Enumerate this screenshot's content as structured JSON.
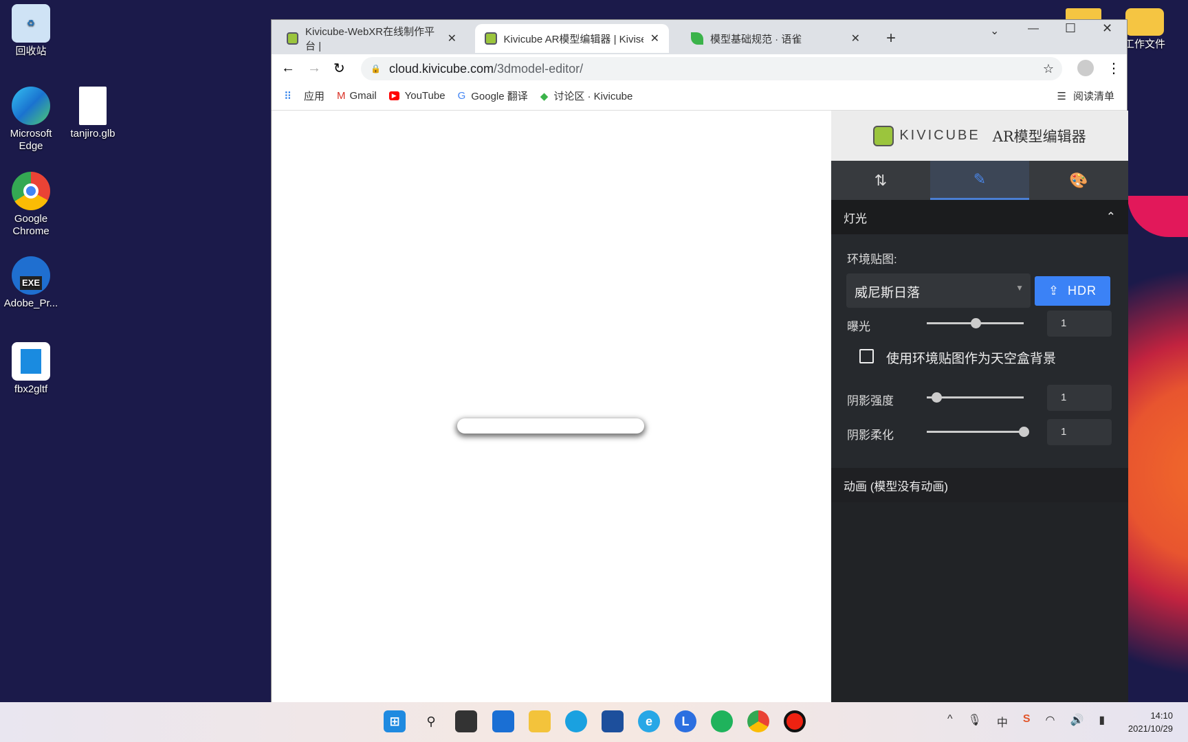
{
  "desktop": {
    "icons": [
      {
        "label": "回收站"
      },
      {
        "label": "Microsoft Edge"
      },
      {
        "label": "tanjiro.glb"
      },
      {
        "label": "Google Chrome"
      },
      {
        "label": "Adobe_Pr..."
      },
      {
        "label": "fbx2gltf"
      },
      {
        "label": "工作文件"
      }
    ],
    "exe_badge": "EXE"
  },
  "browser": {
    "tabs": [
      {
        "title": "Kivicube-WebXR在线制作平台 |"
      },
      {
        "title": "Kivicube AR模型编辑器 | Kivise"
      },
      {
        "title": "模型基础规范 · 语雀"
      }
    ],
    "new_tab": "+",
    "url_host": "cloud.kivicube.com",
    "url_path": "/3dmodel-editor/",
    "bookmarks": [
      "应用",
      "Gmail",
      "YouTube",
      "Google 翻译",
      "讨论区 · Kivicube"
    ],
    "reading_list": "阅读清单"
  },
  "panel": {
    "brand": "KIVICUBE",
    "title": "AR模型编辑器",
    "tabs": [
      {
        "icon": "transform-arrows-icon"
      },
      {
        "icon": "pencil-icon",
        "active": true
      },
      {
        "icon": "palette-icon"
      }
    ],
    "section": "灯光",
    "env_label": "环境贴图:",
    "env_value": "威尼斯日落",
    "hdr_button": "HDR",
    "exposure": {
      "label": "曝光",
      "value": "1",
      "slider": 0.5
    },
    "skybox_label": "使用环境贴图作为天空盒背景",
    "skybox_checked": false,
    "shadow_intensity": {
      "label": "阴影强度",
      "value": "1",
      "slider": 0.1
    },
    "shadow_softness": {
      "label": "阴影柔化",
      "value": "1",
      "slider": 1.0
    },
    "animation": "动画 (模型没有动画)",
    "accent": "#3b82f6"
  },
  "taskbar": {
    "time": "14:10",
    "date": "2021/10/29",
    "ime": "中"
  }
}
